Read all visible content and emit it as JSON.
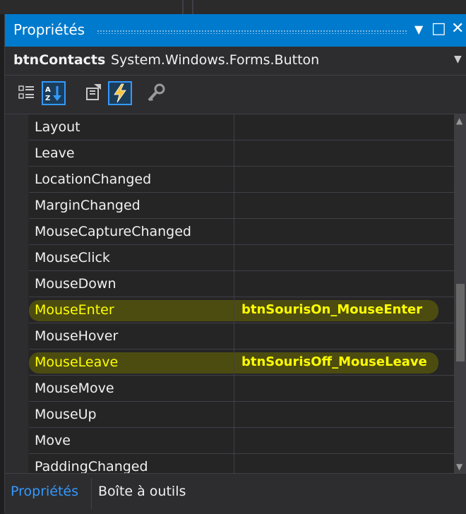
{
  "panel": {
    "title": "Propriétés",
    "controls": {
      "dropdown": "▼",
      "maximize": "□",
      "close": "✕"
    }
  },
  "object_selector": {
    "name": "btnContacts",
    "type": "System.Windows.Forms.Button"
  },
  "toolbar": {
    "buttons": [
      {
        "icon": "categorized-icon",
        "active": false
      },
      {
        "icon": "alphabetical-icon",
        "active": true
      },
      {
        "icon": "properties-icon",
        "active": false
      },
      {
        "icon": "events-icon",
        "active": true
      },
      {
        "icon": "property-pages-icon",
        "active": false
      }
    ]
  },
  "events": [
    {
      "name": "Layout",
      "handler": ""
    },
    {
      "name": "Leave",
      "handler": ""
    },
    {
      "name": "LocationChanged",
      "handler": ""
    },
    {
      "name": "MarginChanged",
      "handler": ""
    },
    {
      "name": "MouseCaptureChanged",
      "handler": ""
    },
    {
      "name": "MouseClick",
      "handler": ""
    },
    {
      "name": "MouseDown",
      "handler": ""
    },
    {
      "name": "MouseEnter",
      "handler": "btnSourisOn_MouseEnter",
      "highlighted": true
    },
    {
      "name": "MouseHover",
      "handler": ""
    },
    {
      "name": "MouseLeave",
      "handler": "btnSourisOff_MouseLeave",
      "highlighted": true
    },
    {
      "name": "MouseMove",
      "handler": ""
    },
    {
      "name": "MouseUp",
      "handler": ""
    },
    {
      "name": "Move",
      "handler": ""
    },
    {
      "name": "PaddingChanged",
      "handler": ""
    }
  ],
  "tabs": [
    {
      "label": "Propriétés",
      "active": true
    },
    {
      "label": "Boîte à outils",
      "active": false
    }
  ],
  "colors": {
    "accent": "#007acc",
    "highlight_text": "#ffff00",
    "background": "#252526"
  }
}
